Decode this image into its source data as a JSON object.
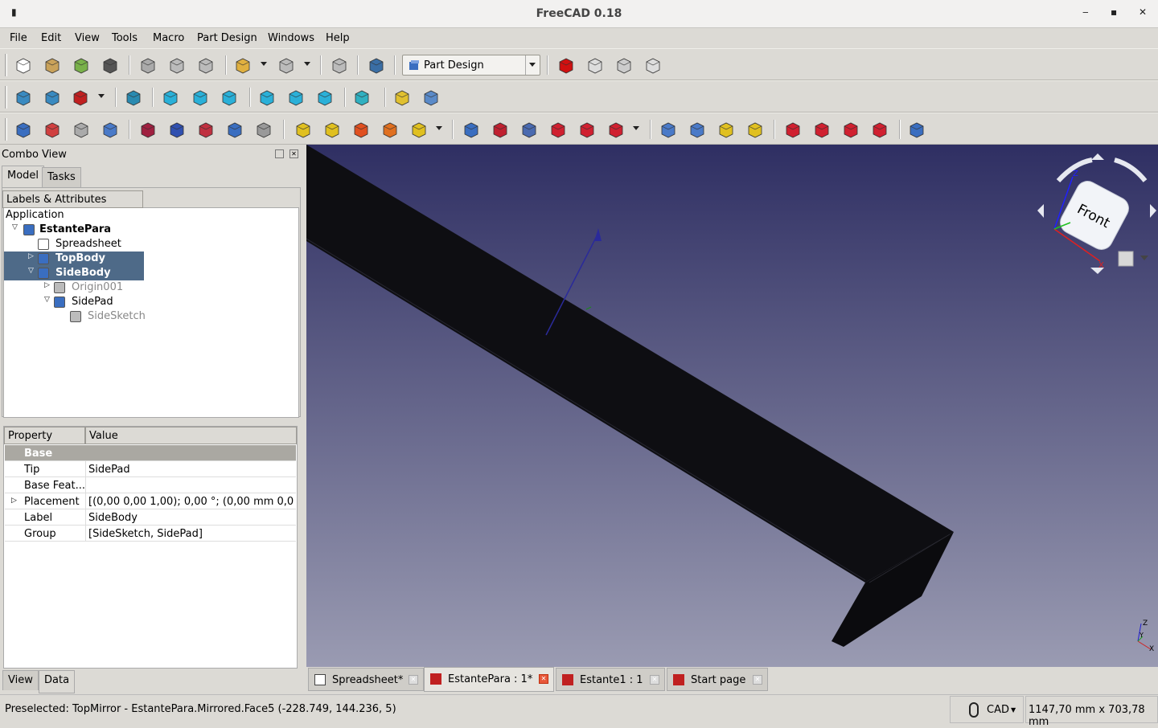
{
  "window": {
    "title": "FreeCAD 0.18",
    "controls": [
      "minimize",
      "maximize",
      "close"
    ]
  },
  "menu": [
    "File",
    "Edit",
    "View",
    "Tools",
    "Macro",
    "Part Design",
    "Windows",
    "Help"
  ],
  "toolbar1": {
    "icons": [
      {
        "n": "new-icon",
        "c": "#fff"
      },
      {
        "n": "open-icon",
        "c": "#c9a25a"
      },
      {
        "n": "save-icon",
        "c": "#79b14a"
      },
      {
        "n": "print-icon",
        "c": "#555"
      },
      {
        "n": "cut-icon",
        "c": "#aaa"
      },
      {
        "n": "copy-icon",
        "c": "#bbb"
      },
      {
        "n": "paste-icon",
        "c": "#bbb"
      },
      {
        "n": "undo-icon",
        "c": "#e0b040"
      },
      {
        "n": "redo-icon",
        "c": "#bbb"
      },
      {
        "n": "refresh-icon",
        "c": "#bbb"
      },
      {
        "n": "whats-this-icon",
        "c": "#3a6ea5"
      }
    ],
    "workbench": "Part Design",
    "macro_icons": [
      {
        "n": "record-macro-icon",
        "c": "#d01010"
      },
      {
        "n": "stop-macro-icon",
        "c": "#ddd"
      },
      {
        "n": "edit-macro-icon",
        "c": "#ccc"
      },
      {
        "n": "run-macro-icon",
        "c": "#ddd"
      }
    ]
  },
  "toolbar2": {
    "icons": [
      {
        "n": "fit-all-icon",
        "c": "#3a8ac0"
      },
      {
        "n": "fit-selection-icon",
        "c": "#3a8ac0"
      },
      {
        "n": "draw-style-icon",
        "c": "#c02020"
      },
      {
        "n": "isometric-icon",
        "c": "#2a8ab0"
      },
      {
        "n": "front-view-icon",
        "c": "#2ab0d8"
      },
      {
        "n": "top-view-icon",
        "c": "#2ab0d8"
      },
      {
        "n": "right-view-icon",
        "c": "#2ab0d8"
      },
      {
        "n": "rear-view-icon",
        "c": "#2ab0d8"
      },
      {
        "n": "bottom-view-icon",
        "c": "#2ab0d8"
      },
      {
        "n": "left-view-icon",
        "c": "#2ab0d8"
      },
      {
        "n": "measure-icon",
        "c": "#30b0c0"
      },
      {
        "n": "part-icon",
        "c": "#e0c030"
      },
      {
        "n": "group-icon",
        "c": "#5a8ac8"
      }
    ]
  },
  "toolbar3": {
    "icons": [
      {
        "n": "body-icon",
        "c": "#3a6ec0"
      },
      {
        "n": "sketch-icon",
        "c": "#d04040"
      },
      {
        "n": "validate-sketch-icon",
        "c": "#aaa"
      },
      {
        "n": "shape-binder-icon",
        "c": "#4a7ac8"
      },
      {
        "n": "datum-point-icon",
        "c": "#a02040"
      },
      {
        "n": "datum-line-icon",
        "c": "#3050b0"
      },
      {
        "n": "datum-plane-icon",
        "c": "#c03040"
      },
      {
        "n": "local-cs-icon",
        "c": "#3a6ec0"
      },
      {
        "n": "clone-icon",
        "c": "#999"
      },
      {
        "n": "pad-icon",
        "c": "#e0c020"
      },
      {
        "n": "revolution-icon",
        "c": "#e0c020"
      },
      {
        "n": "additive-loft-icon",
        "c": "#e05020"
      },
      {
        "n": "additive-pipe-icon",
        "c": "#e07020"
      },
      {
        "n": "additive-primitive-icon",
        "c": "#e0c020"
      },
      {
        "n": "pocket-icon",
        "c": "#3a6ec0"
      },
      {
        "n": "hole-icon",
        "c": "#c02030"
      },
      {
        "n": "groove-icon",
        "c": "#4a6ab0"
      },
      {
        "n": "subtractive-loft-icon",
        "c": "#d02030"
      },
      {
        "n": "subtractive-pipe-icon",
        "c": "#d02030"
      },
      {
        "n": "subtractive-primitive-icon",
        "c": "#d02030"
      },
      {
        "n": "mirrored-icon",
        "c": "#4a7ac8"
      },
      {
        "n": "linear-pattern-icon",
        "c": "#4a7ac8"
      },
      {
        "n": "polar-pattern-icon",
        "c": "#e0c020"
      },
      {
        "n": "multitransform-icon",
        "c": "#e0c020"
      },
      {
        "n": "fillet-icon",
        "c": "#d02030"
      },
      {
        "n": "chamfer-icon",
        "c": "#d02030"
      },
      {
        "n": "draft-icon",
        "c": "#d02030"
      },
      {
        "n": "thickness-icon",
        "c": "#d02030"
      },
      {
        "n": "boolean-icon",
        "c": "#3a6ec0"
      }
    ]
  },
  "combo": {
    "title": "Combo View",
    "tabs": [
      "Model",
      "Tasks"
    ],
    "tree_header": "Labels & Attributes",
    "tree": [
      {
        "label": "Application"
      },
      {
        "label": "EstantePara",
        "bold": true
      },
      {
        "label": "Spreadsheet"
      },
      {
        "label": "TopBody",
        "selected": true
      },
      {
        "label": "SideBody",
        "selected": true
      },
      {
        "label": "Origin001",
        "dim": true
      },
      {
        "label": "SidePad"
      },
      {
        "label": "SideSketch",
        "dim": true
      }
    ],
    "props": {
      "headers": [
        "Property",
        "Value"
      ],
      "group": "Base",
      "rows": [
        [
          "Tip",
          "SidePad"
        ],
        [
          "Base Feat...",
          ""
        ],
        [
          "Placement",
          "[(0,00 0,00 1,00); 0,00 °; (0,00 mm  0,0..."
        ],
        [
          "Label",
          "SideBody"
        ],
        [
          "Group",
          "[SideSketch, SidePad]"
        ]
      ]
    },
    "bottom_tabs": [
      "View",
      "Data"
    ]
  },
  "navcube": {
    "face": "Front",
    "axes": [
      "X",
      "Y",
      "Z"
    ]
  },
  "doc_tabs": [
    {
      "label": "Spreadsheet*"
    },
    {
      "label": "EstantePara : 1*",
      "active": true
    },
    {
      "label": "Estante1 : 1"
    },
    {
      "label": "Start page"
    }
  ],
  "status": {
    "message": "Preselected: TopMirror - EstantePara.Mirrored.Face5 (-228.749, 144.236, 5)",
    "nav_style": "CAD",
    "dimensions": "1147,70 mm x 703,78 mm"
  }
}
